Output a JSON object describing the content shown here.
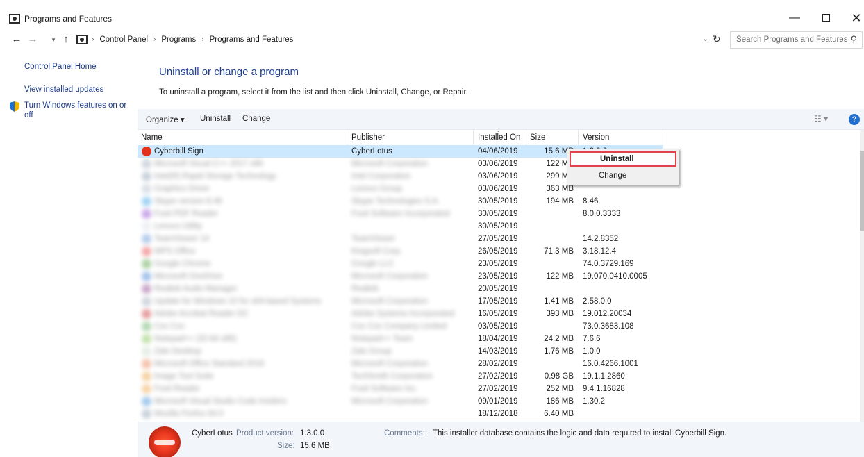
{
  "window": {
    "title": "Programs and Features",
    "minimize": "—",
    "maximize": "",
    "close": "✕"
  },
  "address": {
    "breadcrumb": [
      "Control Panel",
      "Programs",
      "Programs and Features"
    ],
    "search_placeholder": "Search Programs and Features"
  },
  "leftnav": {
    "home": "Control Panel Home",
    "updates": "View installed updates",
    "features": "Turn Windows features on or off"
  },
  "main": {
    "heading": "Uninstall or change a program",
    "instructions": "To uninstall a program, select it from the list and then click Uninstall, Change, or Repair."
  },
  "toolbar": {
    "organize": "Organize ▾",
    "uninstall": "Uninstall",
    "change": "Change"
  },
  "columns": {
    "name": "Name",
    "publisher": "Publisher",
    "installed_on": "Installed On",
    "size": "Size",
    "version": "Version"
  },
  "rows": [
    {
      "name": "Cyberbill Sign",
      "publisher": "CyberLotus",
      "installed_on": "04/06/2019",
      "size": "15.6 MB",
      "version": "1.3.0.0",
      "selected": true,
      "blurred": false,
      "icon_color": "#e3321c"
    },
    {
      "name": "Microsoft Visual C++ 2017 x86",
      "publisher": "Microsoft Corporation",
      "installed_on": "03/06/2019",
      "size": "122 MB",
      "version": "",
      "blurred": true,
      "icon_color": "#9aa6b8"
    },
    {
      "name": "Intel(R) Rapid Storage Technology",
      "publisher": "Intel Corporation",
      "installed_on": "03/06/2019",
      "size": "299 MB",
      "version": "",
      "blurred": true,
      "icon_color": "#8a9ab0"
    },
    {
      "name": "Graphics Driver",
      "publisher": "Lenovo Group",
      "installed_on": "03/06/2019",
      "size": "363 MB",
      "version": "",
      "blurred": true,
      "icon_color": "#b0b8c8"
    },
    {
      "name": "Skype version 8.46",
      "publisher": "Skype Technologies S.A.",
      "installed_on": "30/05/2019",
      "size": "194 MB",
      "version": "8.46",
      "blurred": true,
      "icon_color": "#2ea0e8"
    },
    {
      "name": "Foxit PDF Reader",
      "publisher": "Foxit Software Incorporated",
      "installed_on": "30/05/2019",
      "size": "",
      "version": "8.0.0.3333",
      "blurred": true,
      "icon_color": "#8a3fd0"
    },
    {
      "name": "Lenovo Utility",
      "publisher": "",
      "installed_on": "30/05/2019",
      "size": "",
      "version": "",
      "blurred": true,
      "icon_color": "#d8dde6"
    },
    {
      "name": "TeamViewer 14",
      "publisher": "TeamViewer",
      "installed_on": "27/05/2019",
      "size": "",
      "version": "14.2.8352",
      "blurred": true,
      "icon_color": "#5b8fd6"
    },
    {
      "name": "WPS Office",
      "publisher": "Kingsoft Corp.",
      "installed_on": "26/05/2019",
      "size": "71.3 MB",
      "version": "3.18.12.4",
      "blurred": true,
      "icon_color": "#e64040"
    },
    {
      "name": "Google Chrome",
      "publisher": "Google LLC",
      "installed_on": "23/05/2019",
      "size": "",
      "version": "74.0.3729.169",
      "blurred": true,
      "icon_color": "#4a9a3a"
    },
    {
      "name": "Microsoft OneDrive",
      "publisher": "Microsoft Corporation",
      "installed_on": "23/05/2019",
      "size": "122 MB",
      "version": "19.070.0410.0005",
      "blurred": true,
      "icon_color": "#3a7bd5"
    },
    {
      "name": "Realtek Audio Manager",
      "publisher": "Realtek",
      "installed_on": "20/05/2019",
      "size": "",
      "version": "",
      "blurred": true,
      "icon_color": "#8a3f8a"
    },
    {
      "name": "Update for Windows 10 for x64-based Systems",
      "publisher": "Microsoft Corporation",
      "installed_on": "17/05/2019",
      "size": "1.41 MB",
      "version": "2.58.0.0",
      "blurred": true,
      "icon_color": "#9aa6b8"
    },
    {
      "name": "Adobe Acrobat Reader DC",
      "publisher": "Adobe Systems Incorporated",
      "installed_on": "16/05/2019",
      "size": "393 MB",
      "version": "19.012.20034",
      "blurred": true,
      "icon_color": "#c62828"
    },
    {
      "name": "Coc Coc",
      "publisher": "Coc Coc Company Limited",
      "installed_on": "03/05/2019",
      "size": "",
      "version": "73.0.3683.108",
      "blurred": true,
      "icon_color": "#5aaa5a"
    },
    {
      "name": "Notepad++ (32-bit x86)",
      "publisher": "Notepad++ Team",
      "installed_on": "18/04/2019",
      "size": "24.2 MB",
      "version": "7.6.6",
      "blurred": true,
      "icon_color": "#7cbf4a"
    },
    {
      "name": "Zalo Desktop",
      "publisher": "Zalo Group",
      "installed_on": "14/03/2019",
      "size": "1.76 MB",
      "version": "1.0.0",
      "blurred": true,
      "icon_color": "#c8d8c8"
    },
    {
      "name": "Microsoft Office Standard 2016",
      "publisher": "Microsoft Corporation",
      "installed_on": "28/02/2019",
      "size": "",
      "version": "16.0.4266.1001",
      "blurred": true,
      "icon_color": "#e8764a"
    },
    {
      "name": "Image Tool Suite",
      "publisher": "TechSmith Corporation",
      "installed_on": "27/02/2019",
      "size": "0.98 GB",
      "version": "19.1.1.2860",
      "blurred": true,
      "icon_color": "#e8a03a"
    },
    {
      "name": "Foxit Reader",
      "publisher": "Foxit Software Inc.",
      "installed_on": "27/02/2019",
      "size": "252 MB",
      "version": "9.4.1.16828",
      "blurred": true,
      "icon_color": "#f0a040"
    },
    {
      "name": "Microsoft Visual Studio Code Insiders",
      "publisher": "Microsoft Corporation",
      "installed_on": "09/01/2019",
      "size": "186 MB",
      "version": "1.30.2",
      "blurred": true,
      "icon_color": "#3a8ad6"
    },
    {
      "name": "Mozilla Firefox 64.0",
      "publisher": "",
      "installed_on": "18/12/2018",
      "size": "6.40 MB",
      "version": "",
      "blurred": true,
      "icon_color": "#8a9ab0"
    }
  ],
  "context_menu": {
    "uninstall": "Uninstall",
    "change": "Change"
  },
  "details": {
    "publisher": "CyberLotus",
    "product_version_label": "Product version:",
    "product_version": "1.3.0.0",
    "size_label": "Size:",
    "size": "15.6 MB",
    "comments_label": "Comments:",
    "comments": "This installer database contains the logic and data required to install Cyberbill Sign."
  },
  "colors": {
    "link": "#1c3a85",
    "heading": "#1e3f94",
    "selected_row": "#cce8ff",
    "toolbar_bg": "#f2f6fb",
    "context_highlight": "#e0434b"
  }
}
